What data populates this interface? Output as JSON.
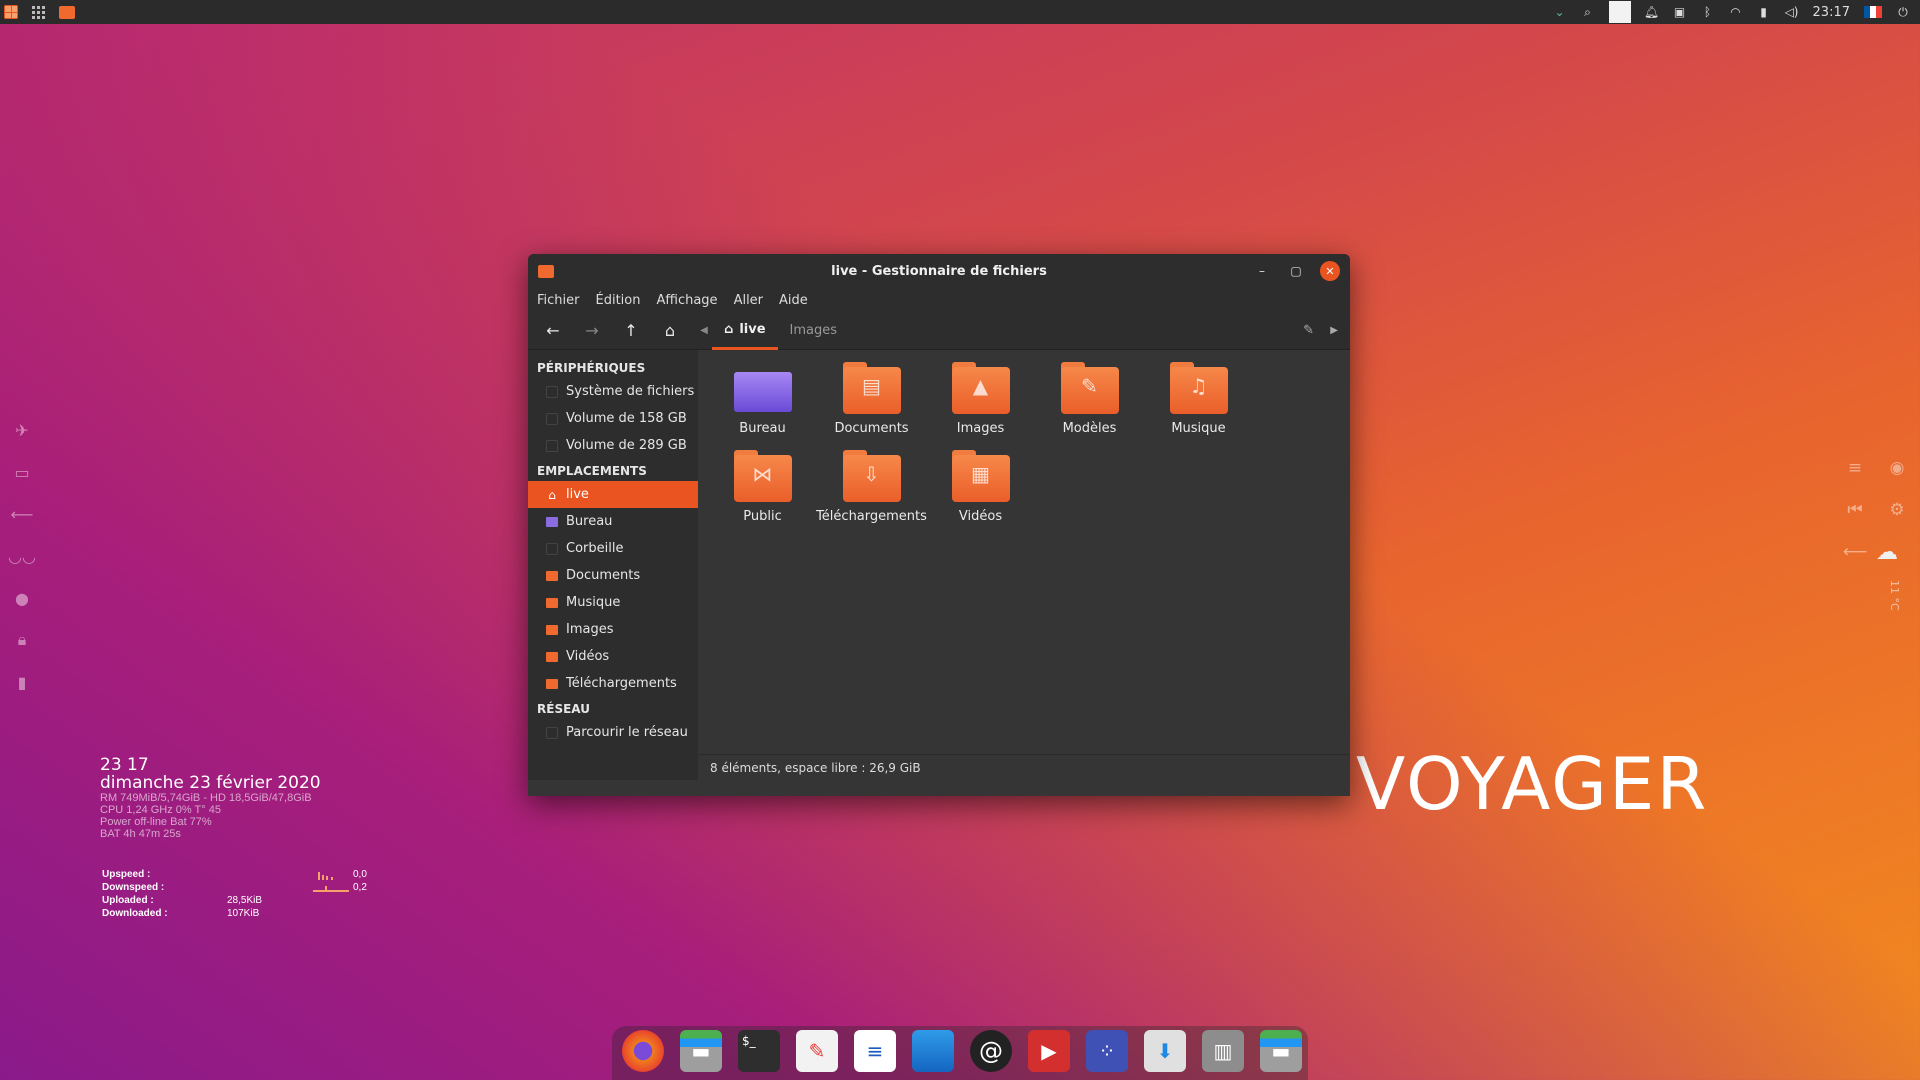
{
  "top_panel": {
    "clock": "23:17",
    "flag_colors": [
      "#0055a4",
      "#ffffff",
      "#ef4135"
    ]
  },
  "window": {
    "title": "live - Gestionnaire de fichiers",
    "menu": [
      "Fichier",
      "Édition",
      "Affichage",
      "Aller",
      "Aide"
    ],
    "path": {
      "current": "live",
      "next": "Images"
    },
    "sidebar": {
      "devices_header": "PÉRIPHÉRIQUES",
      "devices": [
        "Système de fichiers",
        "Volume de 158 GB",
        "Volume de 289 GB"
      ],
      "places_header": "EMPLACEMENTS",
      "places": [
        "live",
        "Bureau",
        "Corbeille",
        "Documents",
        "Musique",
        "Images",
        "Vidéos",
        "Téléchargements"
      ],
      "network_header": "RÉSEAU",
      "network": [
        "Parcourir le réseau"
      ]
    },
    "files": [
      "Bureau",
      "Documents",
      "Images",
      "Modèles",
      "Musique",
      "Public",
      "Téléchargements",
      "Vidéos"
    ],
    "status": "8 éléments, espace libre : 26,9 GiB"
  },
  "conky": {
    "time": "23 17",
    "date": "dimanche 23 février 2020",
    "ram": "RM 749MiB/5,74GiB - HD 18,5GiB/47,8GiB",
    "cpu": "CPU 1,24 GHz 0% T° 45",
    "power": "Power off-line Bat 77%",
    "battery": "BAT 4h 47m 25s",
    "net": {
      "upspeed_label": "Upspeed :",
      "upspeed": "0,0",
      "downspeed_label": "Downspeed :",
      "downspeed": "0,2",
      "uploaded_label": "Uploaded :",
      "uploaded": "28,5KiB",
      "downloaded_label": "Downloaded :",
      "downloaded": "107KiB"
    }
  },
  "brand": "VOYAGER",
  "weather_temp": "11 °C",
  "accent": "#e95420"
}
